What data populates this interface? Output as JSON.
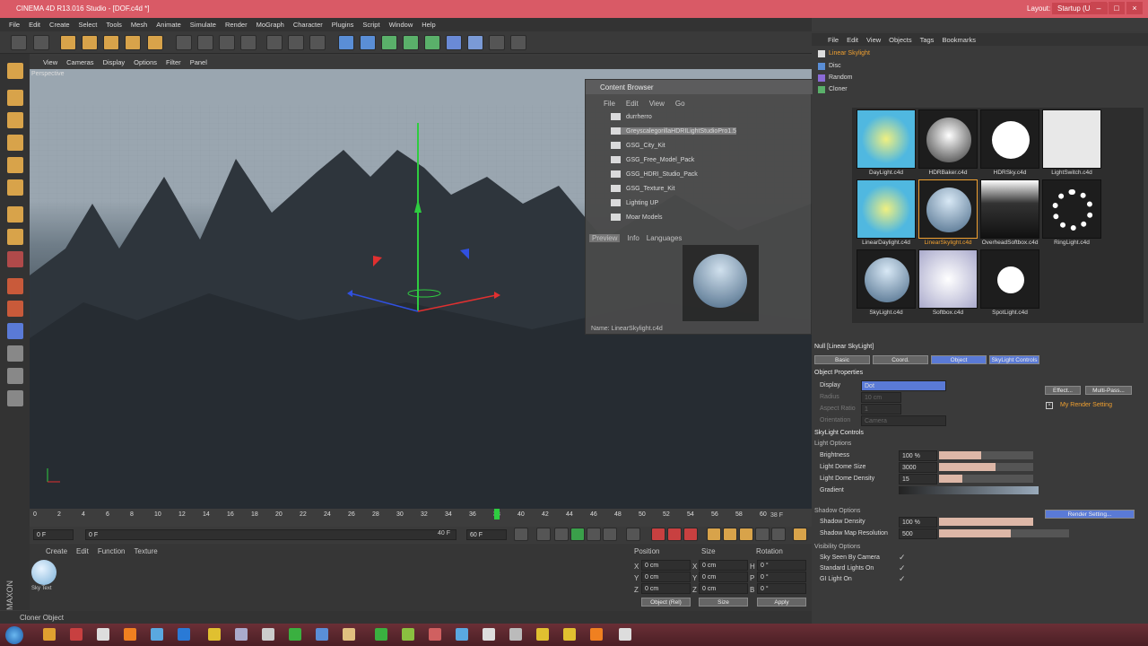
{
  "window": {
    "title": "CINEMA 4D R13.016 Studio - [DOF.c4d *]",
    "layout_label": "Layout:",
    "layout_value": "Startup (User)"
  },
  "menu": [
    "File",
    "Edit",
    "Create",
    "Select",
    "Tools",
    "Mesh",
    "Animate",
    "Simulate",
    "Render",
    "MoGraph",
    "Character",
    "Plugins",
    "Script",
    "Window",
    "Help"
  ],
  "viewport": {
    "menu": [
      "View",
      "Cameras",
      "Display",
      "Options",
      "Filter",
      "Panel"
    ],
    "label": "Perspective"
  },
  "timeline": {
    "ticks": [
      "0",
      "2",
      "4",
      "6",
      "8",
      "10",
      "12",
      "14",
      "16",
      "18",
      "20",
      "22",
      "24",
      "26",
      "28",
      "30",
      "32",
      "34",
      "36",
      "38",
      "40",
      "42",
      "44",
      "46",
      "48",
      "50",
      "52",
      "54",
      "56",
      "58",
      "60"
    ],
    "end_frame": "38 F",
    "start_field": "0 F",
    "cur_field": "0 F",
    "range_end": "40 F",
    "max_field": "60 F"
  },
  "material_panel": {
    "menu": [
      "Create",
      "Edit",
      "Function",
      "Texture"
    ],
    "material_name": "Sky Text"
  },
  "coords": {
    "headers": [
      "Position",
      "Size",
      "Rotation"
    ],
    "rows": [
      {
        "a": "X",
        "v1": "0 cm",
        "b": "X",
        "v2": "0 cm",
        "c": "H",
        "v3": "0 °"
      },
      {
        "a": "Y",
        "v1": "0 cm",
        "b": "Y",
        "v2": "0 cm",
        "c": "P",
        "v3": "0 °"
      },
      {
        "a": "Z",
        "v1": "0 cm",
        "b": "Z",
        "v2": "0 cm",
        "c": "B",
        "v3": "0 °"
      }
    ],
    "mode": "Object (Rel)",
    "size_mode": "Size",
    "apply": "Apply"
  },
  "status": "Cloner Object",
  "object_manager": {
    "menu": [
      "File",
      "Edit",
      "View",
      "Objects",
      "Tags",
      "Bookmarks"
    ],
    "objects": [
      "Linear Skylight",
      "Disc",
      "Random",
      "Cloner"
    ]
  },
  "content_browser": {
    "title": "Content Browser",
    "menu": [
      "File",
      "Edit",
      "View",
      "Go"
    ],
    "folders": [
      "durrherro",
      "GreyscalegorillaHDRILightStudioPro1.5",
      "GSG_City_Kit",
      "GSG_Free_Model_Pack",
      "GSG_HDRI_Studio_Pack",
      "GSG_Texture_Kit",
      "Lighting UP",
      "Moar Models"
    ],
    "tabs": [
      "Preview",
      "Info",
      "Languages"
    ],
    "name_label": "Name: LinearSkylight.c4d"
  },
  "thumbs": [
    "DayLight.c4d",
    "HDRBaker.c4d",
    "HDRSky.c4d",
    "LightSwitch.c4d",
    "LinearDaylight.c4d",
    "LinearSkylight.c4d",
    "OverheadSoftbox.c4d",
    "RingLight.c4d",
    "SkyLight.c4d",
    "Softbox.c4d",
    "SpotLight.c4d"
  ],
  "attributes": {
    "header": "Null [Linear SkyLight]",
    "tabs": [
      "Basic",
      "Coord.",
      "Object",
      "SkyLight Controls"
    ],
    "object_props": "Object Properties",
    "display_label": "Display",
    "display_value": "Dot",
    "radius_label": "Radius",
    "radius_value": "10 cm",
    "aspect_label": "Aspect Ratio",
    "aspect_value": "1",
    "orientation_label": "Orientation",
    "orientation_value": "Camera",
    "skylight_controls": "SkyLight Controls",
    "light_options": "Light Options",
    "brightness_label": "Brightness",
    "brightness_value": "100 %",
    "brightness_fill": 0.45,
    "dome_size_label": "Light Dome Size",
    "dome_size_value": "3000",
    "dome_size_fill": 0.6,
    "dome_density_label": "Light Dome Density",
    "dome_density_value": "15",
    "dome_density_fill": 0.25,
    "gradient_label": "Gradient",
    "shadow_options": "Shadow Options",
    "shadow_density_label": "Shadow Density",
    "shadow_density_value": "100 %",
    "shadow_density_fill": 1.0,
    "shadow_map_label": "Shadow Map Resolution",
    "shadow_map_value": "500",
    "shadow_map_fill": 0.55,
    "visibility_options": "Visibility Options",
    "sky_seen_label": "Sky Seen By Camera",
    "standard_lights_label": "Standard Lights On",
    "gi_light_label": "GI Light On"
  },
  "render_settings": {
    "effect": "Effect...",
    "multipass": "Multi-Pass...",
    "item": "My Render Setting",
    "button": "Render Setting..."
  },
  "colors": {
    "accent": "#d95a66",
    "slider": "#ddb7a7",
    "selected": "#f0a030"
  }
}
